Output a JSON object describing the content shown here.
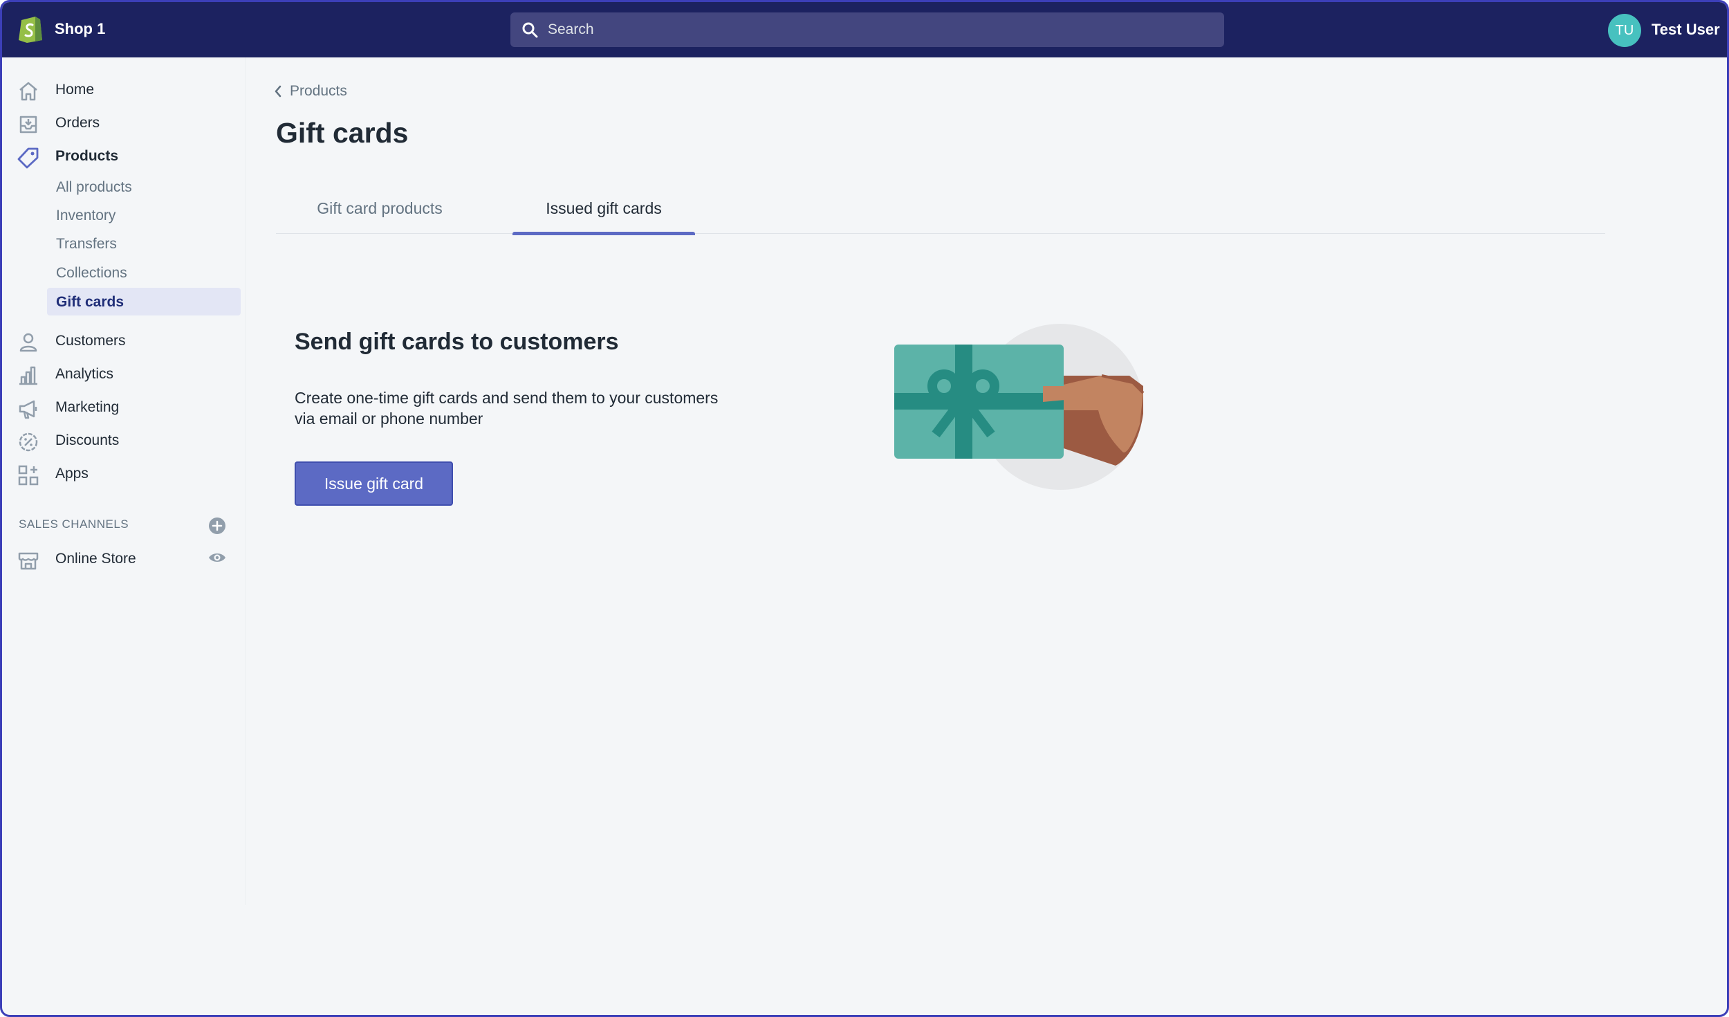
{
  "topbar": {
    "shop_name": "Shop 1",
    "search_placeholder": "Search",
    "avatar_initials": "TU",
    "user_name": "Test User"
  },
  "sidebar": {
    "items": [
      {
        "label": "Home",
        "icon": "home-icon"
      },
      {
        "label": "Orders",
        "icon": "orders-icon"
      },
      {
        "label": "Products",
        "icon": "tag-icon",
        "active": true
      },
      {
        "label": "Customers",
        "icon": "person-icon"
      },
      {
        "label": "Analytics",
        "icon": "bar-chart-icon"
      },
      {
        "label": "Marketing",
        "icon": "megaphone-icon"
      },
      {
        "label": "Discounts",
        "icon": "discount-icon"
      },
      {
        "label": "Apps",
        "icon": "apps-icon"
      }
    ],
    "product_subitems": [
      "All products",
      "Inventory",
      "Transfers",
      "Collections",
      "Gift cards"
    ],
    "selected_subitem": "Gift cards",
    "sales_channels_title": "SALES CHANNELS",
    "channels": [
      {
        "label": "Online Store",
        "icon": "store-icon"
      }
    ]
  },
  "main": {
    "breadcrumb": "Products",
    "title": "Gift cards",
    "tabs": [
      {
        "label": "Gift card products",
        "selected": false
      },
      {
        "label": "Issued gift cards",
        "selected": true
      }
    ],
    "empty_state": {
      "heading": "Send gift cards to customers",
      "description": "Create one-time gift cards and send them to your customers via email or phone number",
      "button_label": "Issue gift card"
    }
  },
  "colors": {
    "topbar": "#1c2260",
    "accent": "#5c6ac4",
    "avatar": "#47c1bf"
  }
}
